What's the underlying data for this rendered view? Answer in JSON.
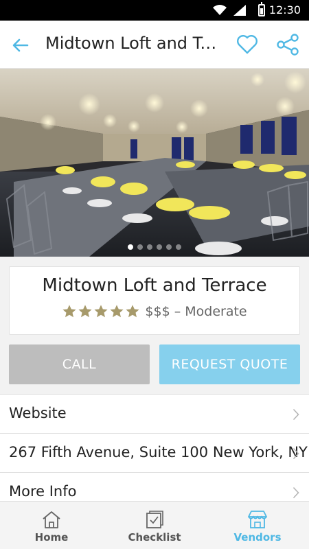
{
  "status_bar": {
    "time": "12:30"
  },
  "header": {
    "title": "Midtown Loft and Te..."
  },
  "gallery": {
    "page_count": 6,
    "active_index": 0
  },
  "venue": {
    "name": "Midtown Loft and Terrace",
    "star_rating": 5,
    "price_text": "$$$ – Moderate"
  },
  "actions": {
    "call_label": "CALL",
    "quote_label": "REQUEST QUOTE"
  },
  "details": {
    "items": [
      {
        "label": "Website"
      },
      {
        "label": "267 Fifth Avenue, Suite 100 New York, NY"
      },
      {
        "label": "More Info"
      }
    ]
  },
  "bottom_nav": {
    "items": [
      {
        "label": "Home",
        "icon": "home-icon"
      },
      {
        "label": "Checklist",
        "icon": "checklist-icon"
      },
      {
        "label": "Vendors",
        "icon": "store-icon",
        "active": true
      }
    ]
  },
  "colors": {
    "accent": "#4fb8e4",
    "quote_button": "#86d0ed",
    "call_button": "#bdbdbd",
    "star": "#a79a6b"
  }
}
